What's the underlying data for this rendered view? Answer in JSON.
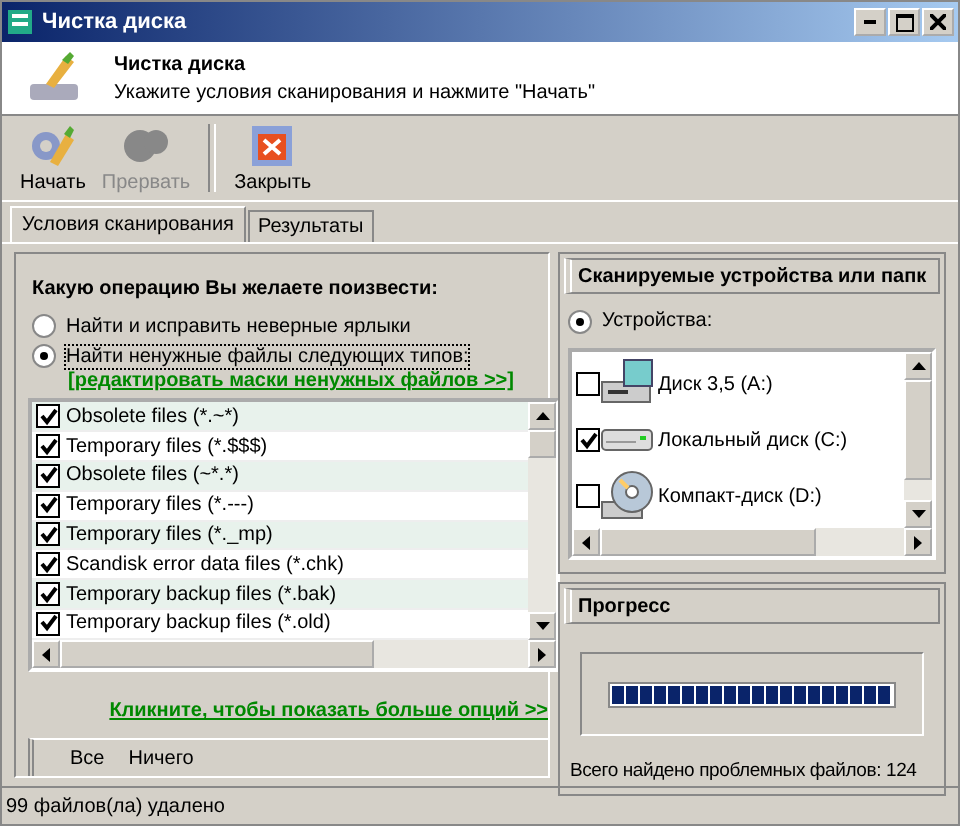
{
  "window": {
    "title": "Чистка диска"
  },
  "header": {
    "title": "Чистка диска",
    "subtitle": "Укажите условия сканирования и нажмите \"Начать\""
  },
  "toolbar": [
    {
      "label": "Начать",
      "kind": "start",
      "disabled": false
    },
    {
      "label": "Прервать",
      "kind": "stop",
      "disabled": true
    },
    {
      "label": "Закрыть",
      "kind": "close",
      "disabled": false
    }
  ],
  "tabs": [
    {
      "label": "Условия сканирования",
      "selected": true
    },
    {
      "label": "Результаты",
      "selected": false
    }
  ],
  "question": "Какую операцию Вы желаете поизвести:",
  "options": [
    {
      "label": "Найти и исправить неверные ярлыки",
      "selected": false
    },
    {
      "label": "Найти ненужные файлы следующих типов:",
      "selected": true
    }
  ],
  "edit_masks_link": "[редактировать маски ненужных файлов >>]",
  "file_types": [
    {
      "label": "Obsolete files (*.~*)",
      "checked": true
    },
    {
      "label": "Temporary files (*.$$$)",
      "checked": true
    },
    {
      "label": "Obsolete files (~*.*)",
      "checked": true
    },
    {
      "label": "Temporary files (*.---)",
      "checked": true
    },
    {
      "label": "Temporary files (*._mp)",
      "checked": true
    },
    {
      "label": "Scandisk error data files (*.chk)",
      "checked": true
    },
    {
      "label": "Temporary backup files (*.bak)",
      "checked": true
    },
    {
      "label": "Temporary backup files (*.old)",
      "checked": true
    }
  ],
  "more_options_link": "Кликните, чтобы показать больше опций >>",
  "select_buttons": [
    "Все",
    "Ничего"
  ],
  "devices_panel": {
    "title": "Сканируемые устройства или папк",
    "radio": {
      "label": "Устройства:",
      "selected": true
    },
    "devices": [
      {
        "label": "Диск 3,5 (A:)",
        "kind": "floppy",
        "checked": false
      },
      {
        "label": "Локальный диск (C:)",
        "kind": "hdd",
        "checked": true
      },
      {
        "label": "Компакт-диск (D:)",
        "kind": "cd",
        "checked": false
      }
    ]
  },
  "progress_panel": {
    "title": "Прогресс",
    "level": 1,
    "summary": "Всего найдено проблемных файлов: 124"
  },
  "status_bar": "99 файлов(ла) удалено"
}
